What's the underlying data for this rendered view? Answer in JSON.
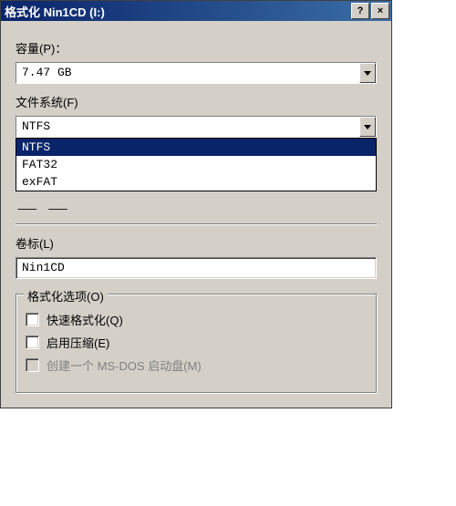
{
  "titlebar": {
    "title": "格式化 Nin1CD (I:)",
    "help_label": "?",
    "close_label": "×"
  },
  "capacity": {
    "label": "容量(P)：",
    "value": "7.47 GB"
  },
  "filesystem": {
    "label": "文件系统(F)",
    "value": "NTFS",
    "options": [
      "NTFS",
      "FAT32",
      "exFAT"
    ]
  },
  "alloc": {
    "obscured_text": "⸺ ⸺"
  },
  "volume": {
    "label": "卷标(L)",
    "value": "Nin1CD"
  },
  "options": {
    "group_label": "格式化选项(O)",
    "quick_label": "快速格式化(Q)",
    "compress_label": "启用压缩(E)",
    "msdos_label": "创建一个 MS-DOS 启动盘(M)"
  }
}
